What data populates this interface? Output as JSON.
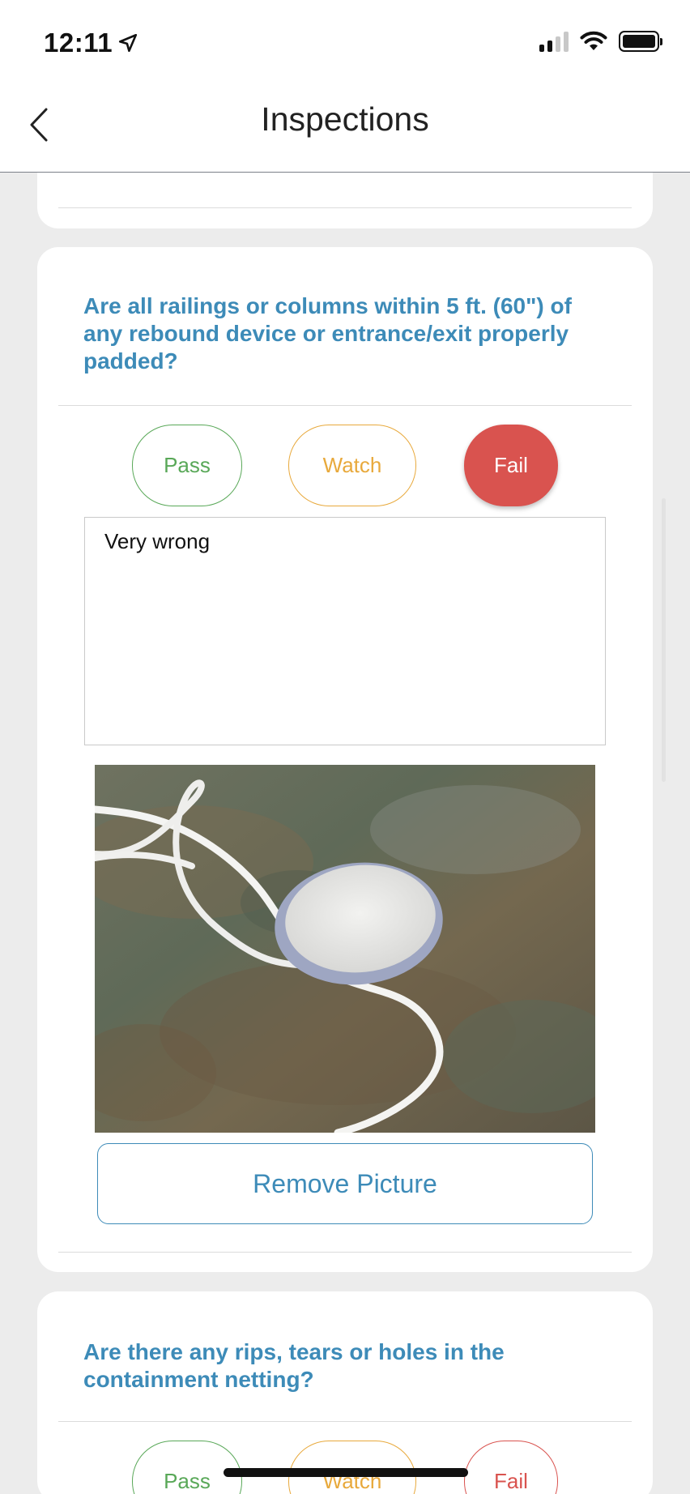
{
  "status_bar": {
    "time": "12:11",
    "location_icon": "location-arrow-icon",
    "signal_icon": "cellular-signal-icon",
    "wifi_icon": "wifi-icon",
    "battery_icon": "battery-icon"
  },
  "header": {
    "title": "Inspections",
    "back_icon": "chevron-left-icon"
  },
  "questions": [
    {
      "text": "Are all railings or columns within 5 ft. (60\") of any rebound device or entrance/exit properly padded?",
      "choices": {
        "pass": "Pass",
        "watch": "Watch",
        "fail": "Fail"
      },
      "selected": "Fail",
      "notes": "Very wrong",
      "remove_picture_label": "Remove Picture"
    },
    {
      "text": "Are there any rips, tears or holes in the containment netting?",
      "choices": {
        "pass": "Pass",
        "watch": "Watch",
        "fail": "Fail"
      }
    }
  ],
  "colors": {
    "question_text": "#3d8bb8",
    "pass": "#59a858",
    "watch": "#e8a93c",
    "fail": "#d9534f",
    "background": "#ececec"
  }
}
